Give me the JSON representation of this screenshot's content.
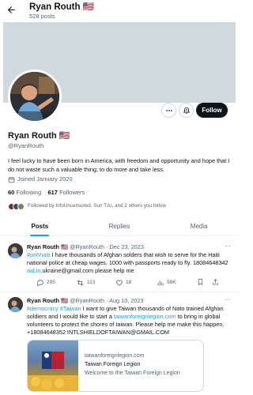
{
  "header": {
    "name": "Ryan Routh",
    "flag": "🇺🇸",
    "posts": "528 posts"
  },
  "profile": {
    "name": "Ryan Routh",
    "flag": "🇺🇸",
    "handle": "@RyanRouth",
    "bio": "I feel lucky to have been born in America, with freedom and opportunity and hope that I do not waste such a valuable thing; to do more and take less.",
    "joined": "Joined January 2020",
    "following_count": "60",
    "following_label": "Following",
    "followers_count": "617",
    "followers_label": "Followers",
    "followed_by": "Followed by InfoUncensored, Sun Tzu, and 2 others you follow",
    "follow_label": "Follow"
  },
  "tabs": [
    {
      "label": "Posts",
      "active": true
    },
    {
      "label": "Replies",
      "active": false
    },
    {
      "label": "Media",
      "active": false
    }
  ],
  "tweets": [
    {
      "name": "Ryan Routh",
      "flag": "🇺🇸",
      "handle": "@RyanRouth",
      "sep": "·",
      "date": "Dec 23, 2023",
      "hashtag": "#pnhhaiti",
      "text1": " I have thousands of Afghan solders that wish to serve for the Haiti national police at cheap wages. 1000 with passports ready to fly. 18084648342 ",
      "link": "aid.in",
      "text2": ".ukraine@gmail.com please help me",
      "replies": "295",
      "reposts": "113",
      "likes": "18",
      "views": "98K"
    },
    {
      "name": "Ryan Routh",
      "flag": "🇺🇸",
      "handle": "@RyanRouth",
      "sep": "·",
      "date": "Aug 10, 2023",
      "hashtag1": "#democracy",
      "hashtag2": "#Taiwan",
      "text1": " I want to give Taiwan thousands of Nato trained Afghan soldiers and I would like to start a ",
      "link": "taiwanforeignlegion.com",
      "text2": " to bring in global volunteers to protect the shores of taiwan.   Please help me make this happen. +18084648352 INTLSHIELDOFTAIWAN@GMAIL.COM",
      "card": {
        "domain": "taiwanforeignlegion.com",
        "title": "Taiwan Foreign Legion",
        "description": "Welcome to the Taiwan Foreign Legion"
      }
    }
  ],
  "icons": {
    "back": "arrow-left-icon",
    "more": "more-icon",
    "notify": "bell-plus-icon",
    "calendar": "calendar-icon"
  },
  "colors": {
    "accent": "#1d9bf0",
    "text": "#0f1419",
    "muted": "#536471",
    "banner": "#cfd9de",
    "follow_bg": "#0f1419"
  }
}
